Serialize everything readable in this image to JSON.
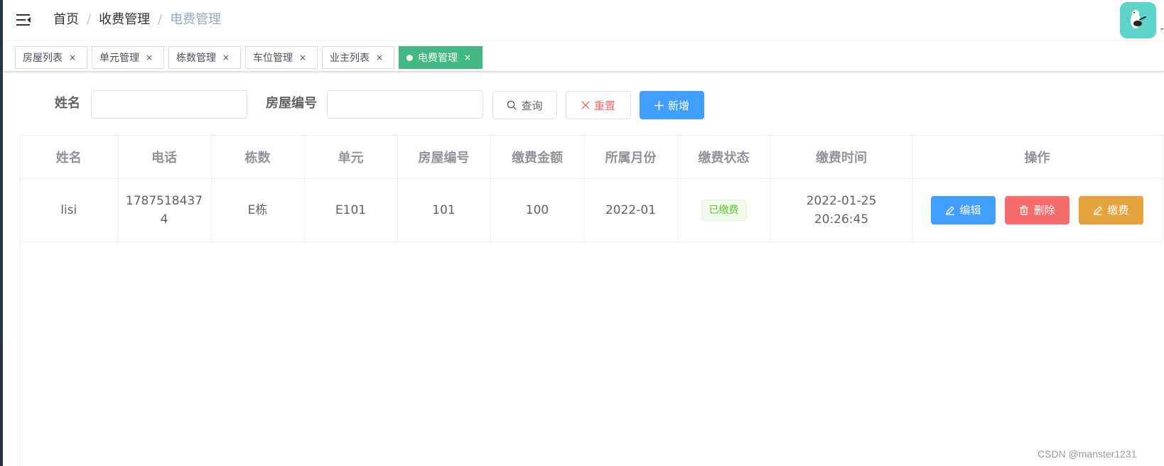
{
  "breadcrumb": {
    "home": "首页",
    "section": "收费管理",
    "current": "电费管理",
    "separator": "/"
  },
  "tags": [
    {
      "label": "房屋列表",
      "close": "×"
    },
    {
      "label": "单元管理",
      "close": "×"
    },
    {
      "label": "栋数管理",
      "close": "×"
    },
    {
      "label": "车位管理",
      "close": "×"
    },
    {
      "label": "业主列表",
      "close": "×"
    },
    {
      "label": "电费管理",
      "close": "×",
      "active": true
    }
  ],
  "search": {
    "name_label": "姓名",
    "name_value": "",
    "house_label": "房屋编号",
    "house_value": "",
    "query_label": "查询",
    "reset_label": "重置",
    "add_label": "新增"
  },
  "table": {
    "headers": [
      "姓名",
      "电话",
      "栋数",
      "单元",
      "房屋编号",
      "缴费金额",
      "所属月份",
      "缴费状态",
      "缴费时间",
      "操作"
    ],
    "rows": [
      {
        "name": "lisi",
        "phone_line1": "1787518437",
        "phone_line2": "4",
        "building": "E栋",
        "unit": "E101",
        "house_no": "101",
        "amount": "100",
        "month": "2022-01",
        "status": "已缴费",
        "pay_time": "2022-01-25 20:26:45",
        "edit_label": "编辑",
        "delete_label": "删除",
        "pay_label": "缴费"
      }
    ]
  },
  "colors": {
    "primary": "#409eff",
    "danger": "#f56c6c",
    "warning": "#e6a23c",
    "success": "#67c23a",
    "tag_active": "#42b983"
  },
  "icons": {
    "menu": "hamburger-fold-icon",
    "search": "search-icon",
    "reset": "close-icon",
    "add": "plus-icon",
    "edit": "edit-icon",
    "delete": "trash-icon",
    "pay": "edit-icon"
  },
  "watermark": "CSDN @manster1231"
}
